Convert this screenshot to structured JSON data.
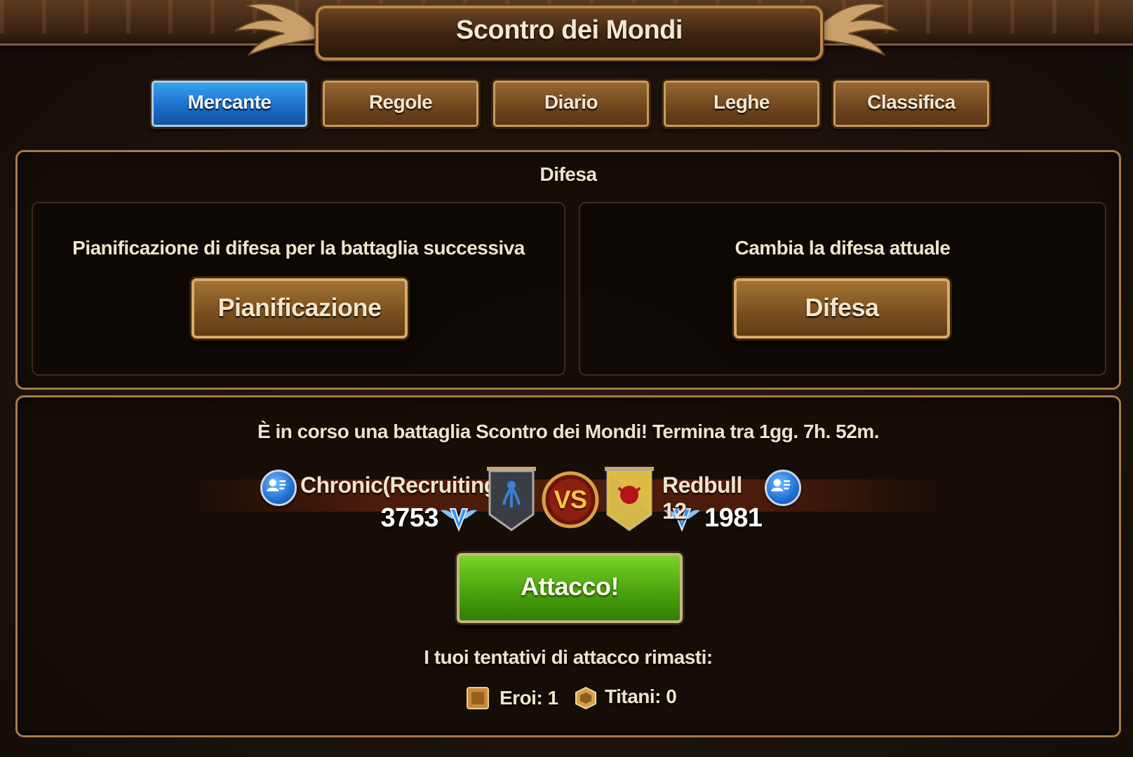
{
  "header": {
    "title": "Scontro dei Mondi"
  },
  "tabs": [
    {
      "label": "Mercante",
      "active": true
    },
    {
      "label": "Regole",
      "active": false
    },
    {
      "label": "Diario",
      "active": false
    },
    {
      "label": "Leghe",
      "active": false
    },
    {
      "label": "Classifica",
      "active": false
    }
  ],
  "defense": {
    "title": "Difesa",
    "plan": {
      "description": "Pianificazione di difesa per la battaglia successiva",
      "button": "Pianificazione"
    },
    "change": {
      "description": "Cambia la difesa attuale",
      "button": "Difesa"
    }
  },
  "battle": {
    "status": "È in corso una battaglia Scontro dei Mondi! Termina tra 1gg. 7h. 52m.",
    "left_team": {
      "name": "Chronic(Recruiting)",
      "points": "3753"
    },
    "vs_label": "VS",
    "right_team": {
      "name": "Redbull 12",
      "points": "1981"
    },
    "attack_button": "Attacco!",
    "attempts_label": "I tuoi tentativi di attacco rimasti:",
    "heroes": "Eroi: 1",
    "titans": "Titani: 0"
  },
  "colors": {
    "active_tab": "#1b6fcc",
    "gold_button": "#7c5020",
    "attack_button": "#49a40d",
    "panel_border": "#a77a4a"
  },
  "icons": [
    "profile-icon",
    "guild-banner-icon",
    "vs-badge-icon",
    "league-wings-icon",
    "hero-attempt-icon",
    "titan-attempt-icon"
  ]
}
